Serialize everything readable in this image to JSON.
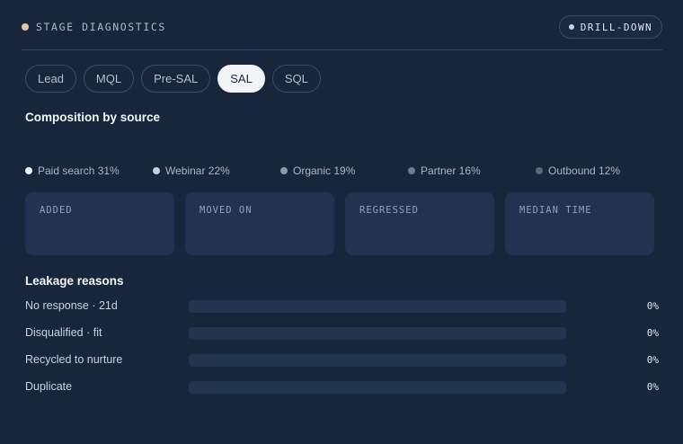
{
  "header": {
    "title": "STAGE DIAGNOSTICS",
    "drill_label": "DRILL-DOWN"
  },
  "tabs": [
    {
      "label": "Lead",
      "active": false
    },
    {
      "label": "MQL",
      "active": false
    },
    {
      "label": "Pre-SAL",
      "active": false
    },
    {
      "label": "SAL",
      "active": true
    },
    {
      "label": "SQL",
      "active": false
    }
  ],
  "composition": {
    "title": "Composition by source",
    "legend": [
      {
        "label": "Paid search 31%",
        "color": "#f2f5f9"
      },
      {
        "label": "Webinar 22%",
        "color": "#c7d1de"
      },
      {
        "label": "Organic 19%",
        "color": "#8d99ab"
      },
      {
        "label": "Partner 16%",
        "color": "#6e7b8e"
      },
      {
        "label": "Outbound 12%",
        "color": "#586577"
      }
    ]
  },
  "stats": [
    {
      "label": "ADDED"
    },
    {
      "label": "MOVED ON"
    },
    {
      "label": "REGRESSED"
    },
    {
      "label": "MEDIAN TIME"
    }
  ],
  "leakage": {
    "title": "Leakage reasons",
    "reasons": [
      {
        "label": "No response · 21d",
        "value": "0%",
        "fraction": 0
      },
      {
        "label": "Disqualified · fit",
        "value": "0%",
        "fraction": 0
      },
      {
        "label": "Recycled to nurture",
        "value": "0%",
        "fraction": 0
      },
      {
        "label": "Duplicate",
        "value": "0%",
        "fraction": 0
      }
    ]
  }
}
